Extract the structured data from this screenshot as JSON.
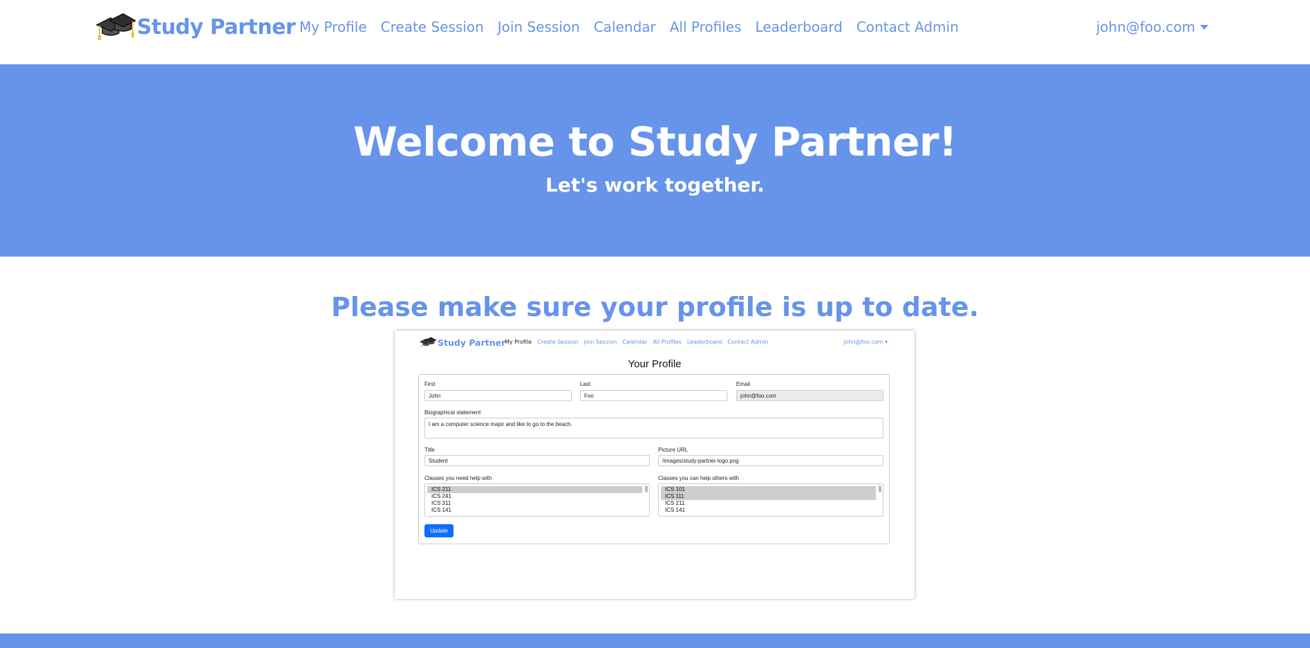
{
  "nav": {
    "brand": "Study Partner",
    "links": [
      "My Profile",
      "Create Session",
      "Join Session",
      "Calendar",
      "All Profiles",
      "Leaderboard",
      "Contact Admin"
    ],
    "user": "john@foo.com"
  },
  "hero": {
    "title": "Welcome to Study Partner!",
    "subtitle": "Let's work together."
  },
  "main": {
    "reminder": "Please make sure your profile is up to date."
  },
  "preview": {
    "brand": "Study Partner",
    "links": [
      "My Profile",
      "Create Session",
      "Join Session",
      "Calendar",
      "All Profiles",
      "Leaderboard",
      "Contact Admin"
    ],
    "user": "john@foo.com",
    "page_title": "Your Profile",
    "form": {
      "first_label": "First",
      "first_value": "John",
      "last_label": "Last",
      "last_value": "Foo",
      "email_label": "Email",
      "email_value": "john@foo.com",
      "bio_label": "Biographical statement",
      "bio_value": "I am a computer science major and like to go to the beach.",
      "title_label": "Title",
      "title_value": "Student",
      "picture_label": "Picture URL",
      "picture_value": "/images/study-partner-logo.png",
      "need_label": "Classes you need help with",
      "need_options": [
        "ICS 211",
        "ICS 241",
        "ICS 311",
        "ICS 141"
      ],
      "can_label": "Classes you can help others with",
      "can_options": [
        "ICS 101",
        "ICS 111",
        "ICS 211",
        "ICS 141"
      ],
      "update_label": "Update"
    }
  },
  "colors": {
    "accent": "#6694ea",
    "button": "#0d6efd"
  }
}
